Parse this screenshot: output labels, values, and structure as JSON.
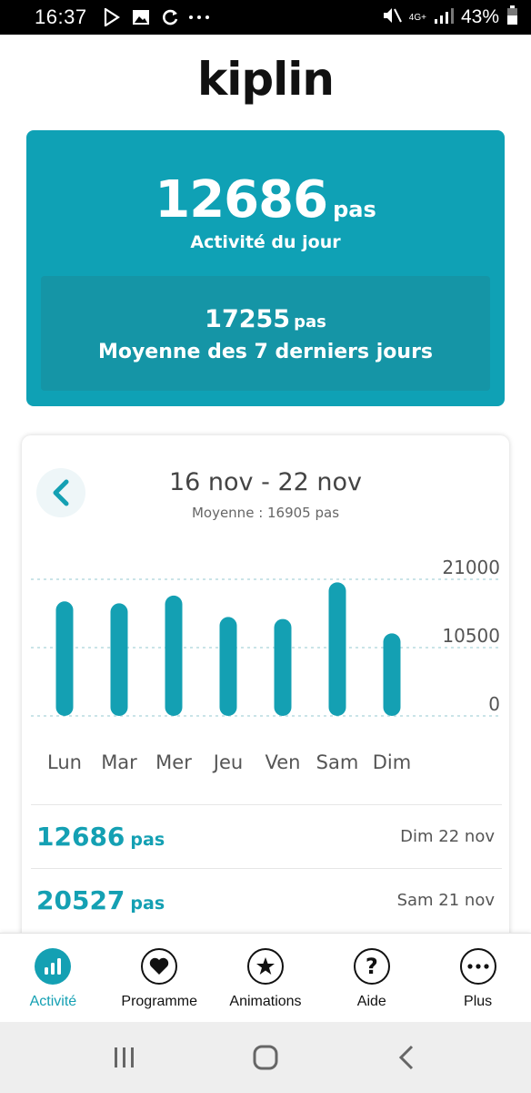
{
  "status_bar": {
    "time": "16:37",
    "battery": "43%",
    "network": "4G+"
  },
  "app": {
    "logo": "kiplin"
  },
  "today": {
    "steps": "12686",
    "unit": "pas",
    "label": "Activité du jour",
    "average_steps": "17255",
    "average_unit": "pas",
    "average_label": "Moyenne des 7 derniers jours"
  },
  "week": {
    "range": "16 nov - 22 nov",
    "average": "Moyenne : 16905 pas"
  },
  "chart_data": {
    "type": "bar",
    "categories": [
      "Lun",
      "Mar",
      "Mer",
      "Jeu",
      "Ven",
      "Sam",
      "Dim"
    ],
    "values": [
      17600,
      17300,
      18500,
      15200,
      14900,
      20527,
      12686
    ],
    "y_ticks": [
      "21000",
      "10500",
      "0"
    ],
    "ylim": [
      0,
      21000
    ],
    "grid": true,
    "bar_color": "#14a0b3"
  },
  "history": [
    {
      "steps": "12686",
      "unit": "pas",
      "date": "Dim 22 nov"
    },
    {
      "steps": "20527",
      "unit": "pas",
      "date": "Sam 21 nov"
    }
  ],
  "nav": [
    {
      "label": "Activité",
      "icon": "bar-chart-icon",
      "active": true
    },
    {
      "label": "Programme",
      "icon": "heart-icon",
      "active": false
    },
    {
      "label": "Animations",
      "icon": "star-icon",
      "active": false
    },
    {
      "label": "Aide",
      "icon": "question-icon",
      "active": false
    },
    {
      "label": "Plus",
      "icon": "more-icon",
      "active": false
    }
  ],
  "colors": {
    "accent": "#14a0b3",
    "card": "#0fa1b5",
    "card_inner": "#1595a6"
  }
}
